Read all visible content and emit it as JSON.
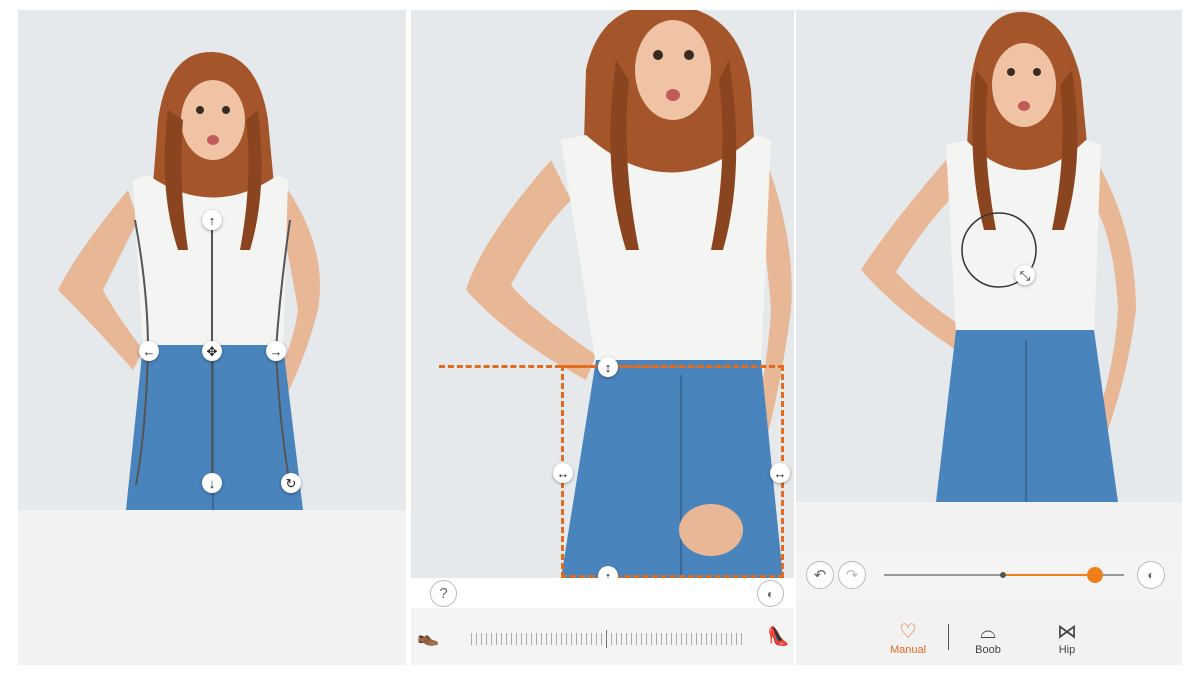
{
  "colors": {
    "accent": "#f07f19",
    "background": "#f2f2f2",
    "photo_bg": "#e6e9ec"
  },
  "panel_left": {
    "handles": {
      "up": "↑",
      "down": "↓",
      "left": "←",
      "right": "→",
      "move": "✥",
      "rotate": "↻"
    }
  },
  "panel_middle": {
    "handles": {
      "vertical": "↕",
      "horizontal": "↔"
    },
    "help_label": "?",
    "slider_left_icon": "flat-shoe-icon",
    "slider_right_icon": "high-heel-icon"
  },
  "panel_right": {
    "resize_handle": "⤡",
    "slider_value": 0.88,
    "tabs": [
      {
        "label": "Manual",
        "icon": "manual-bra-icon",
        "active": true
      },
      {
        "label": "Boob",
        "icon": "bra-icon",
        "active": false
      },
      {
        "label": "Hip",
        "icon": "hip-icon",
        "active": false
      }
    ]
  }
}
